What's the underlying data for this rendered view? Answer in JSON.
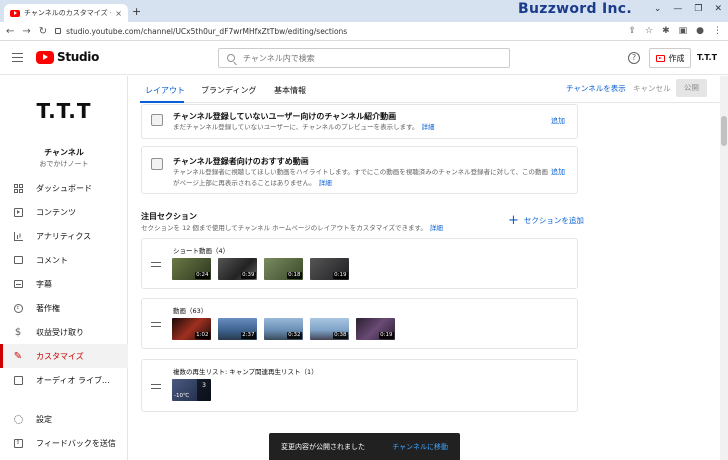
{
  "browser": {
    "tab_title": "チャンネルのカスタマイズ - YouTube S",
    "tab_close": "×",
    "new_tab": "+",
    "brand": "Buzzword Inc.",
    "win": [
      "⌄",
      "—",
      "❐",
      "✕"
    ],
    "nav": [
      "←",
      "→",
      "↻"
    ],
    "url": "studio.youtube.com/channel/UCx5th0ur_dF7wrMHfxZtTbw/editing/sections",
    "tools": [
      "⇪",
      "☆",
      "✱",
      "▣",
      "●",
      "⋮"
    ]
  },
  "header": {
    "logo_text": "Studio",
    "search_placeholder": "チャンネル内で検索",
    "help": "?",
    "create_label": "作成",
    "account": "T.T.T"
  },
  "sidebar": {
    "channel_avatar": "T.T.T",
    "channel_label": "チャンネル",
    "channel_name": "おでかけノート",
    "items": [
      {
        "label": "ダッシュボード",
        "icon": "dashboard-icon"
      },
      {
        "label": "コンテンツ",
        "icon": "content-icon"
      },
      {
        "label": "アナリティクス",
        "icon": "analytics-icon"
      },
      {
        "label": "コメント",
        "icon": "comment-icon"
      },
      {
        "label": "字幕",
        "icon": "subtitles-icon"
      },
      {
        "label": "著作権",
        "icon": "copyright-icon",
        "glyph": "c"
      },
      {
        "label": "収益受け取り",
        "icon": "dollar-icon",
        "glyph": "$"
      },
      {
        "label": "カスタマイズ",
        "icon": "brush-icon",
        "glyph": "✎",
        "active": true
      },
      {
        "label": "オーディオ ライブ...",
        "icon": "audio-library-icon"
      }
    ],
    "bottom_items": [
      {
        "label": "設定",
        "icon": "gear-icon"
      },
      {
        "label": "フィードバックを送信",
        "icon": "feedback-icon",
        "glyph": "!"
      }
    ]
  },
  "tabs": [
    {
      "label": "レイアウト",
      "active": true
    },
    {
      "label": "ブランディング"
    },
    {
      "label": "基本情報"
    }
  ],
  "actions": {
    "view_channel": "チャンネルを表示",
    "cancel": "キャンセル",
    "publish": "公開"
  },
  "cards": [
    {
      "title": "チャンネル登録していないユーザー向けのチャンネル紹介動画",
      "desc": "まだチャンネル登録していないユーザーに、チャンネルのプレビューを表示します。",
      "link": "詳細",
      "add": "追加"
    },
    {
      "title": "チャンネル登録者向けのおすすめ動画",
      "desc": "チャンネル登録者に視聴してほしい動画をハイライトします。すでにこの動画を視聴済みのチャンネル登録者に対して、この動画がページ上部に再表示されることはありません。",
      "link": "詳細",
      "add": "追加"
    }
  ],
  "featured": {
    "title": "注目セクション",
    "desc": "セクションを 12 個まで使用してチャンネル ホームページのレイアウトをカスタマイズできます。",
    "link": "詳細",
    "add": "セクションを追加"
  },
  "shelves": [
    {
      "title": "ショート動画（4）",
      "thumbs": [
        {
          "dur": "0:24",
          "color": "#3e4a2a"
        },
        {
          "dur": "0:39",
          "color": "#2b2b2b"
        },
        {
          "dur": "0:18",
          "color": "#4a5a3a"
        },
        {
          "dur": "0:19",
          "color": "#1f1f24"
        }
      ]
    },
    {
      "title": "動画（63）",
      "thumbs": [
        {
          "dur": "1:02",
          "color": "#5a1a1a"
        },
        {
          "dur": "2:37",
          "color": "#3a5f8a"
        },
        {
          "dur": "0:32",
          "color": "#6a8fb5"
        },
        {
          "dur": "0:38",
          "color": "#7fa4c8"
        },
        {
          "dur": "0:19",
          "color": "#4a3a55"
        }
      ]
    },
    {
      "title": "複数の再生リスト: キャンプ関連再生リスト（1）",
      "thumbs": [
        {
          "dur": "",
          "label": "-10℃",
          "count": "3",
          "color": "#2a3550"
        }
      ]
    }
  ],
  "toast": {
    "message": "変更内容が公開されました",
    "link": "チャンネルに移動"
  },
  "colors": {
    "accent": "#065fd4",
    "active_red": "#cc0000",
    "brand_red": "#ff0000"
  }
}
